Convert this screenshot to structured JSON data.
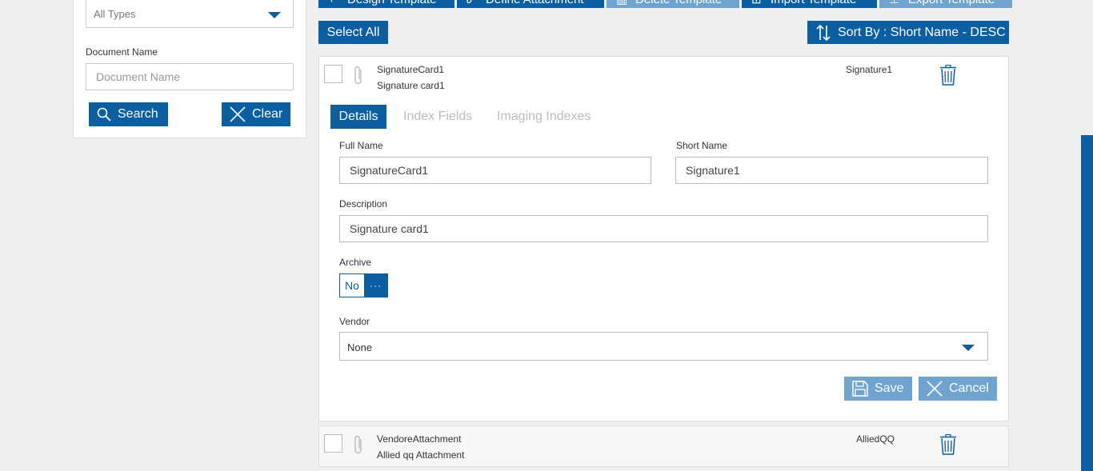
{
  "filters": {
    "type_value": "All Types",
    "doc_name_label": "Document Name",
    "doc_name_placeholder": "Document Name",
    "search_label": "Search",
    "clear_label": "Clear"
  },
  "toolbar": {
    "design_template": "Design Template",
    "define_attachment": "Define Attachment",
    "delete_template": "Delete Template",
    "import_template": "Import Template",
    "export_template": "Export Template",
    "select_all": "Select All",
    "sort_by": "Sort By : Short Name - DESC"
  },
  "templates": [
    {
      "full_name": "SignatureCard1",
      "description": "Signature card1",
      "short_name": "Signature1"
    },
    {
      "full_name": "VendoreAttachment",
      "description": "Allied qq Attachment",
      "short_name": "AlliedQQ"
    }
  ],
  "detail": {
    "tabs": [
      "Details",
      "Index Fields",
      "Imaging Indexes"
    ],
    "full_name_label": "Full Name",
    "full_name_value": "SignatureCard1",
    "short_name_label": "Short Name",
    "short_name_value": "Signature1",
    "description_label": "Description",
    "description_value": "Signature card1",
    "archive_label": "Archive",
    "archive_value": "No",
    "archive_knob": "···",
    "vendor_label": "Vendor",
    "vendor_value": "None",
    "save_label": "Save",
    "cancel_label": "Cancel"
  },
  "colors": {
    "accent": "#0a5fa3",
    "accent_light": "#6fa3d0",
    "background": "#efefef"
  }
}
